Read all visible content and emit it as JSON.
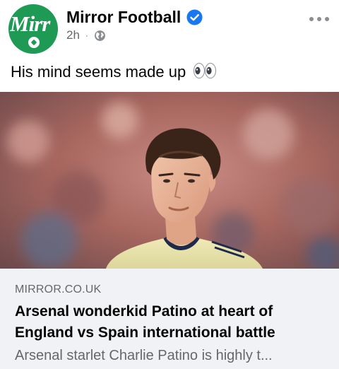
{
  "post": {
    "page_name": "Mirror Football",
    "avatar_text": "Mirr",
    "time": "2h",
    "separator": "·",
    "audience_icon": "globe-icon",
    "more_icon": "more-horizontal-icon",
    "verified_icon": "verified-badge-icon",
    "caption": "His mind seems made up",
    "caption_emoji": "eyes-emoji"
  },
  "link_preview": {
    "domain": "MIRROR.CO.UK",
    "title": "Arsenal wonderkid Patino at heart of England vs Spain international battle",
    "description": "Arsenal starlet Charlie Patino is highly t..."
  },
  "colors": {
    "brand_green": "#1f9a55",
    "verified_blue": "#1877f2",
    "secondary_text": "#65676b",
    "card_background": "#f0f2f5"
  }
}
